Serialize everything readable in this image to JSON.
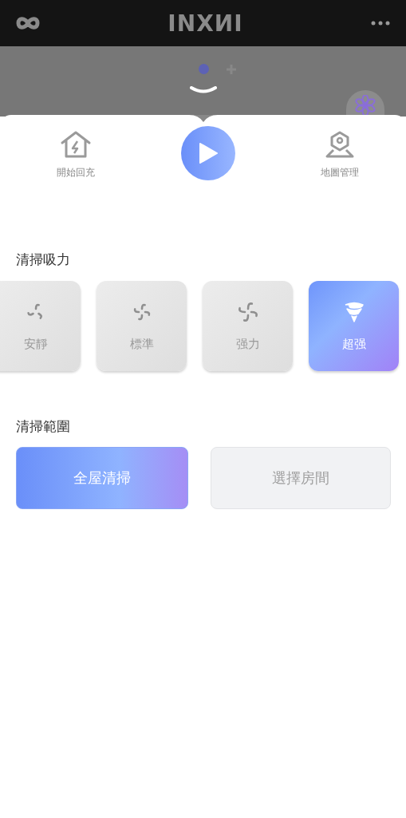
{
  "header": {
    "logo": "INXИI"
  },
  "actions": [
    {
      "kind": "recharge",
      "label": "開始回充"
    },
    {
      "kind": "play"
    },
    {
      "kind": "map",
      "label": "地圖管理"
    }
  ],
  "suction": {
    "title": "清掃吸力",
    "levels": [
      {
        "kind": "quiet",
        "label": "安靜",
        "selected": false
      },
      {
        "kind": "standard",
        "label": "標準",
        "selected": false
      },
      {
        "kind": "strong",
        "label": "强力",
        "selected": false
      },
      {
        "kind": "max",
        "label": "超强",
        "selected": true
      }
    ]
  },
  "range": {
    "title": "清掃範圍",
    "options": [
      {
        "label": "全屋清掃",
        "selected": true
      },
      {
        "label": "選擇房間",
        "selected": false
      }
    ]
  }
}
